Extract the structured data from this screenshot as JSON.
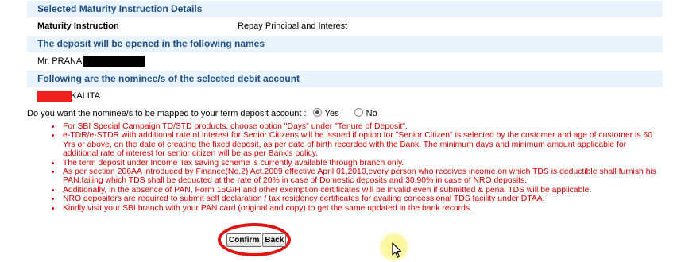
{
  "sections": {
    "maturity_header": "Selected Maturity Instruction Details",
    "maturity_label": "Maturity Instruction",
    "maturity_value": "Repay Principal and Interest",
    "names_header": "The deposit will be opened in the following names",
    "holder_name": "Mr. PRANAB",
    "nominee_header": "Following are the nominee/s of the selected debit account",
    "nominee_name_suffix": "KALITA"
  },
  "mapping": {
    "question": "Do you want the nominee/s to be mapped to your term deposit account :",
    "yes_label": "Yes",
    "no_label": "No",
    "selected": "Yes"
  },
  "notes": [
    "For SBI Special Campaign TD/STD products, choose option \"Days\" under \"Tenure of Deposit\".",
    "e-TDR/e-STDR with additional rate of interest for Senior Citizens will be issued if option for \"Senior Citizen\" is selected by the customer and age of customer is 60 Yrs or above, on the date of creating the fixed deposit, as per date of birth recorded with the Bank. The minimum days and minimum amount applicable for additional rate of interest for senior citizen will be as per Bank's policy.",
    "The term deposit under Income Tax saving scheme is currently available through branch only.",
    "As per section 206AA introduced by Finance(No.2) Act.2009 effective April 01,2010,every person who receives income on which TDS is deductible shall furnish his PAN,failing which TDS shall be deducted at the rate of 20% in case of Domestic deposits and 30.90% in case of NRO deposits.",
    "Additionally, in the absence of PAN, Form 15G/H and other exemption certificates will be invalid even if submitted & penal TDS will be applicable.",
    "NRO depositors are required to submit self declaration / tax residency certificates for availing concessional TDS facility under DTAA.",
    "Kindly visit your SBI branch with your PAN card (original and copy) to get the same updated in the bank records."
  ],
  "buttons": {
    "confirm": "Confirm",
    "back": "Back"
  },
  "colors": {
    "header_bg": "#e9f3fb",
    "header_text": "#1d4f86",
    "note_text": "#d10000",
    "annotation_circle": "#e01414"
  }
}
